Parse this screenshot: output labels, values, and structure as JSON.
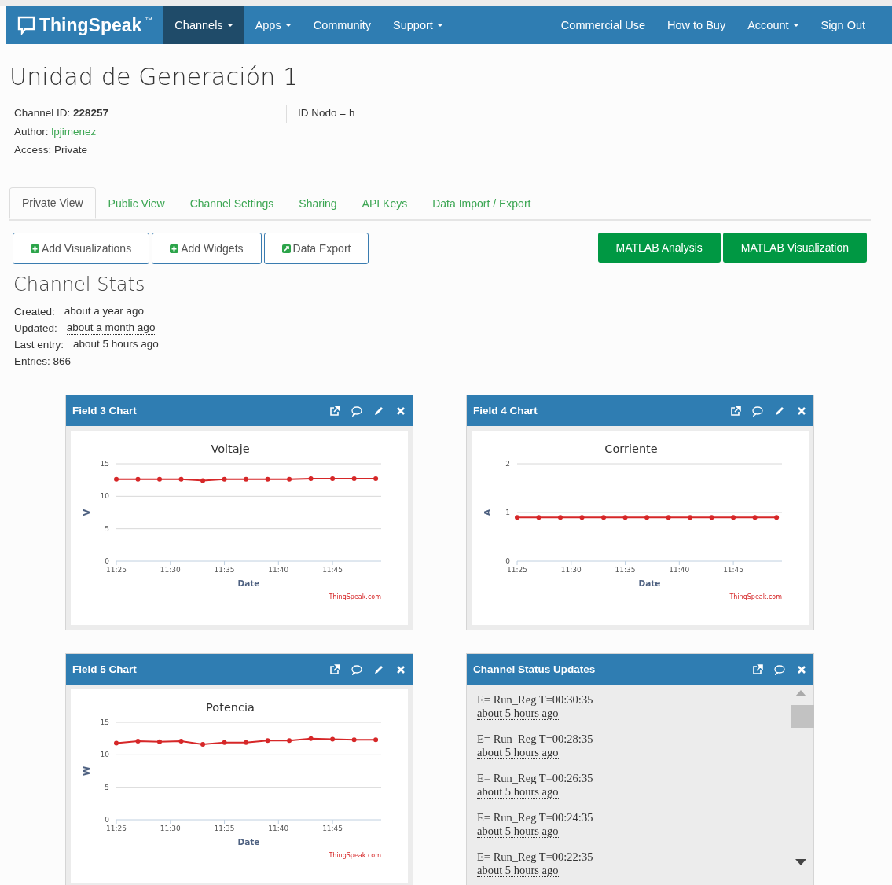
{
  "nav": {
    "logo": "ThingSpeak",
    "trademark": "™",
    "left_items": [
      {
        "label": "Channels",
        "dropdown": true,
        "selected": true
      },
      {
        "label": "Apps",
        "dropdown": true,
        "selected": false
      },
      {
        "label": "Community",
        "dropdown": false,
        "selected": false
      },
      {
        "label": "Support",
        "dropdown": true,
        "selected": false
      }
    ],
    "right_items": [
      {
        "label": "Commercial Use",
        "dropdown": false,
        "selected": false
      },
      {
        "label": "How to Buy",
        "dropdown": false,
        "selected": false
      },
      {
        "label": "Account",
        "dropdown": true,
        "selected": false
      },
      {
        "label": "Sign Out",
        "dropdown": false,
        "selected": false
      }
    ]
  },
  "channel": {
    "title": "Unidad de Generación 1",
    "id_label": "Channel ID:",
    "id": "228257",
    "author_label": "Author:",
    "author": "lpjimenez",
    "access": "Access: Private",
    "description": "ID Nodo = h"
  },
  "tabs": [
    {
      "label": "Private View",
      "selected": true
    },
    {
      "label": "Public View",
      "selected": false
    },
    {
      "label": "Channel Settings",
      "selected": false
    },
    {
      "label": "Sharing",
      "selected": false
    },
    {
      "label": "API Keys",
      "selected": false
    },
    {
      "label": "Data Import / Export",
      "selected": false
    }
  ],
  "action_buttons": [
    {
      "label": "Add Visualizations",
      "kind": "add"
    },
    {
      "label": "Add Widgets",
      "kind": "add"
    },
    {
      "label": "Data Export",
      "kind": "export"
    }
  ],
  "matlab_buttons": [
    "MATLAB Analysis",
    "MATLAB Visualization"
  ],
  "stats": {
    "title": "Channel Stats",
    "rows": [
      {
        "label": "Created:",
        "value": "about a year ago"
      },
      {
        "label": "Updated:",
        "value": "about a month ago"
      },
      {
        "label": "Last entry:",
        "value": "about 5 hours ago"
      }
    ],
    "entries": "Entries: 866"
  },
  "widgets": [
    {
      "kind": "chart",
      "title": "Field 3 Chart",
      "credit": "ThingSpeak.com",
      "chart_data": {
        "type": "line",
        "title": "Voltaje",
        "xlabel": "Date",
        "ylabel": "V",
        "x": [
          685,
          687,
          689,
          691,
          693,
          695,
          697,
          699,
          701,
          703,
          705,
          707,
          709
        ],
        "series": [
          {
            "color": "#d62728",
            "marker": "circle",
            "values": [
              12.6,
              12.6,
              12.6,
              12.6,
              12.4,
              12.6,
              12.6,
              12.6,
              12.6,
              12.7,
              12.7,
              12.7,
              12.7
            ]
          }
        ],
        "xlim": [
          685,
          709.5
        ],
        "ylim": [
          0,
          15
        ],
        "xticks": [
          {
            "value": 685,
            "label": "11:25"
          },
          {
            "value": 690,
            "label": "11:30"
          },
          {
            "value": 695,
            "label": "11:35"
          },
          {
            "value": 700,
            "label": "11:40"
          },
          {
            "value": 705,
            "label": "11:45"
          }
        ],
        "yticks": [
          0,
          5,
          10,
          15
        ]
      }
    },
    {
      "kind": "chart",
      "title": "Field 4 Chart",
      "credit": "ThingSpeak.com",
      "chart_data": {
        "type": "line",
        "title": "Corriente",
        "xlabel": "Date",
        "ylabel": "A",
        "x": [
          685,
          687,
          689,
          691,
          693,
          695,
          697,
          699,
          701,
          703,
          705,
          707,
          709
        ],
        "series": [
          {
            "color": "#d62728",
            "marker": "circle",
            "values": [
              0.9,
              0.9,
              0.9,
              0.9,
              0.9,
              0.9,
              0.9,
              0.9,
              0.9,
              0.9,
              0.9,
              0.9,
              0.9
            ]
          }
        ],
        "xlim": [
          685,
          709.5
        ],
        "ylim": [
          0,
          2
        ],
        "xticks": [
          {
            "value": 685,
            "label": "11:25"
          },
          {
            "value": 690,
            "label": "11:30"
          },
          {
            "value": 695,
            "label": "11:35"
          },
          {
            "value": 700,
            "label": "11:40"
          },
          {
            "value": 705,
            "label": "11:45"
          }
        ],
        "yticks": [
          0,
          1,
          2
        ]
      }
    },
    {
      "kind": "chart",
      "title": "Field 5 Chart",
      "credit": "ThingSpeak.com",
      "chart_data": {
        "type": "line",
        "title": "Potencia",
        "xlabel": "Date",
        "ylabel": "W",
        "x": [
          685,
          687,
          689,
          691,
          693,
          695,
          697,
          699,
          701,
          703,
          705,
          707,
          709
        ],
        "series": [
          {
            "color": "#d62728",
            "marker": "circle",
            "values": [
              11.8,
              12.1,
              12.0,
              12.1,
              11.6,
              11.9,
              11.9,
              12.2,
              12.2,
              12.5,
              12.4,
              12.3,
              12.3
            ]
          }
        ],
        "xlim": [
          685,
          709.5
        ],
        "ylim": [
          0,
          15
        ],
        "xticks": [
          {
            "value": 685,
            "label": "11:25"
          },
          {
            "value": 690,
            "label": "11:30"
          },
          {
            "value": 695,
            "label": "11:35"
          },
          {
            "value": 700,
            "label": "11:40"
          },
          {
            "value": 705,
            "label": "11:45"
          }
        ],
        "yticks": [
          0,
          5,
          10,
          15
        ]
      }
    },
    {
      "kind": "status",
      "title": "Channel Status Updates",
      "updates": [
        {
          "text": "E= Run_Reg T=00:30:35",
          "time": "about 5 hours ago"
        },
        {
          "text": "E= Run_Reg T=00:28:35",
          "time": "about 5 hours ago"
        },
        {
          "text": "E= Run_Reg T=00:26:35",
          "time": "about 5 hours ago"
        },
        {
          "text": "E= Run_Reg T=00:24:35",
          "time": "about 5 hours ago"
        },
        {
          "text": "E= Run_Reg T=00:22:35",
          "time": "about 5 hours ago"
        }
      ]
    }
  ]
}
